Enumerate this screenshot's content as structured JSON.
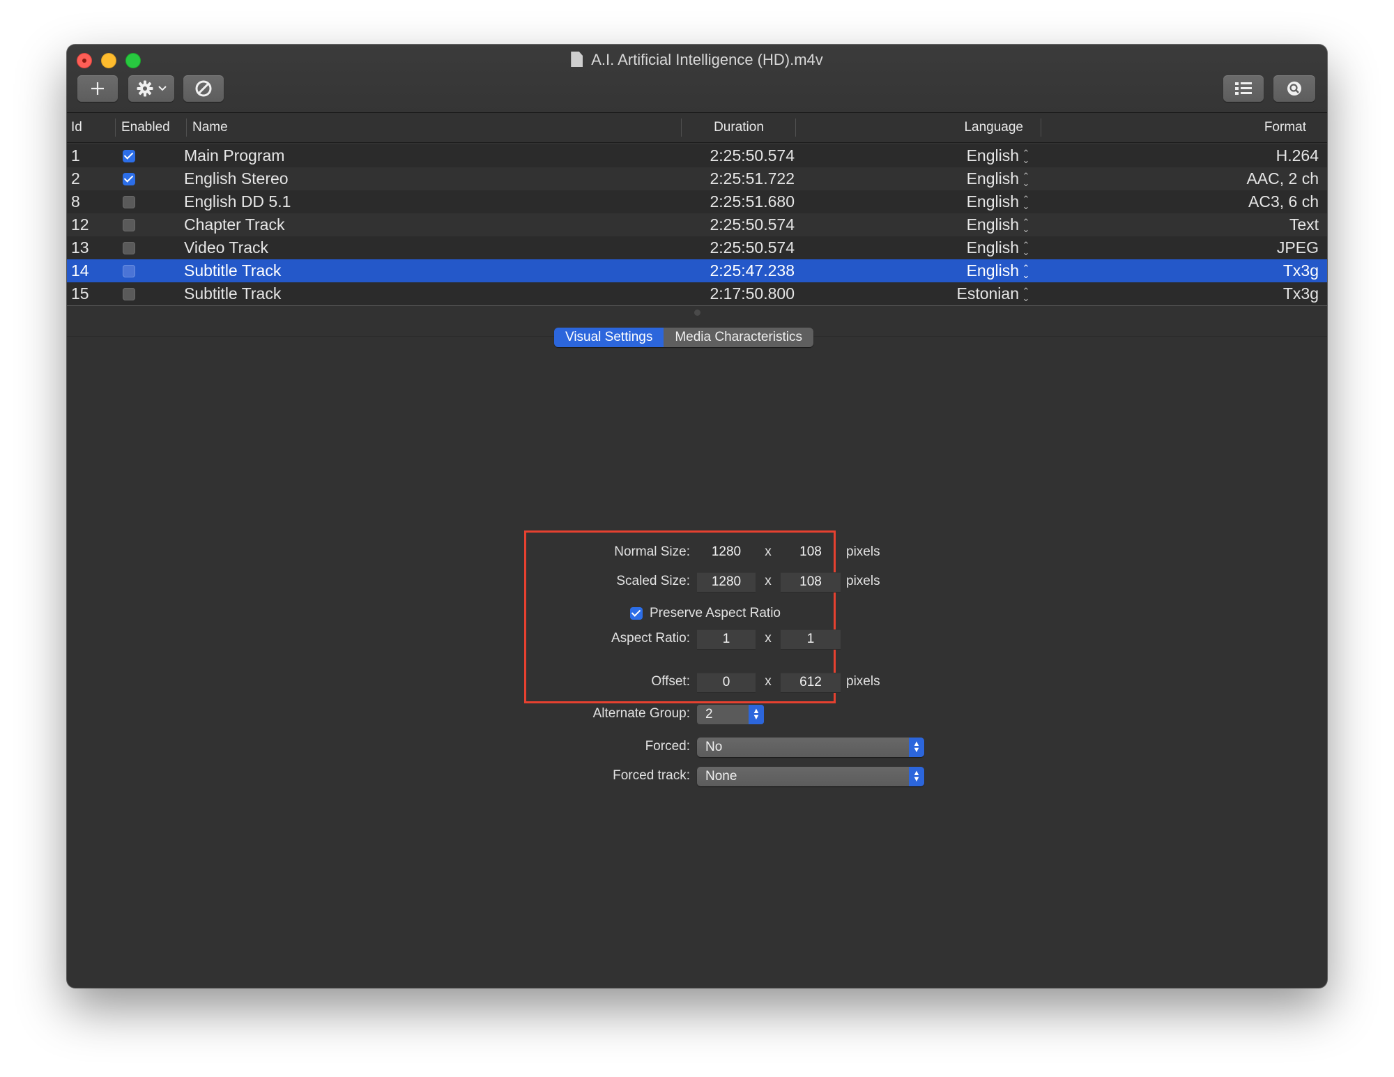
{
  "window": {
    "title": "A.I. Artificial Intelligence (HD).m4v"
  },
  "toolbar": {
    "add_icon": "plus-icon",
    "action_icon": "gear-icon",
    "disable_icon": "prohibited-icon",
    "list_icon": "list-icon",
    "inspect_icon": "magnifier-icon"
  },
  "table": {
    "columns": {
      "id": "Id",
      "enabled": "Enabled",
      "name": "Name",
      "duration": "Duration",
      "language": "Language",
      "format": "Format"
    },
    "rows": [
      {
        "id": "1",
        "enabled": true,
        "name": "Main Program",
        "duration": "2:25:50.574",
        "language": "English",
        "format": "H.264",
        "selected": false
      },
      {
        "id": "2",
        "enabled": true,
        "name": "English Stereo",
        "duration": "2:25:51.722",
        "language": "English",
        "format": "AAC, 2 ch",
        "selected": false
      },
      {
        "id": "8",
        "enabled": false,
        "name": "English DD 5.1",
        "duration": "2:25:51.680",
        "language": "English",
        "format": "AC3, 6 ch",
        "selected": false
      },
      {
        "id": "12",
        "enabled": false,
        "name": "Chapter Track",
        "duration": "2:25:50.574",
        "language": "English",
        "format": "Text",
        "selected": false
      },
      {
        "id": "13",
        "enabled": false,
        "name": "Video Track",
        "duration": "2:25:50.574",
        "language": "English",
        "format": "JPEG",
        "selected": false
      },
      {
        "id": "14",
        "enabled": false,
        "name": "Subtitle Track",
        "duration": "2:25:47.238",
        "language": "English",
        "format": "Tx3g",
        "selected": true
      },
      {
        "id": "15",
        "enabled": false,
        "name": "Subtitle Track",
        "duration": "2:17:50.800",
        "language": "Estonian",
        "format": "Tx3g",
        "selected": false
      }
    ]
  },
  "tabs": {
    "visual": "Visual Settings",
    "media": "Media Characteristics",
    "active": "Visual Settings"
  },
  "visual": {
    "normal_size": {
      "label": "Normal Size:",
      "width": "1280",
      "height": "108",
      "unit": "pixels",
      "sep": "x"
    },
    "scaled_size": {
      "label": "Scaled Size:",
      "width": "1280",
      "height": "108",
      "unit": "pixels",
      "sep": "x"
    },
    "preserve_aspect": {
      "label": "Preserve Aspect Ratio",
      "checked": true
    },
    "aspect_ratio": {
      "label": "Aspect Ratio:",
      "width": "1",
      "height": "1",
      "sep": "x"
    },
    "offset": {
      "label": "Offset:",
      "x": "0",
      "y": "612",
      "unit": "pixels",
      "sep": "x"
    },
    "alternate_group": {
      "label": "Alternate Group:",
      "value": "2"
    },
    "forced": {
      "label": "Forced:",
      "value": "No"
    },
    "forced_track": {
      "label": "Forced track:",
      "value": "None"
    }
  },
  "colors": {
    "selection": "#2458c9",
    "accent": "#2c66dc",
    "highlight_box": "#e64130"
  }
}
